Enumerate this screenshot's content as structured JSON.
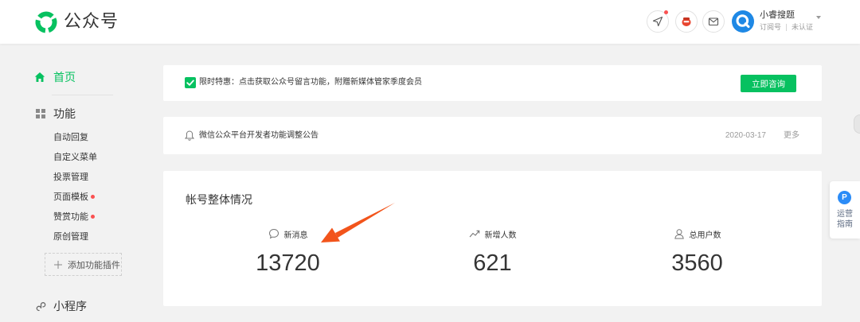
{
  "colors": {
    "accent": "#07c160",
    "badge_red": "#fa5151",
    "avatar_blue": "#1e88e5",
    "guide_blue": "#2b8cf7",
    "annotation_arrow": "#f2541b",
    "page_background": "#f2f2f2"
  },
  "header": {
    "logo_icon": "wechat-mp-logo-icon",
    "logo_text": "公众号",
    "toolbar_icons": [
      "send-icon",
      "wallet-icon",
      "mail-icon"
    ],
    "notification_dot": true,
    "account": {
      "avatar_icon": "avatar",
      "name": "小睿搜题",
      "type": "订阅号",
      "status": "未认证"
    }
  },
  "sidebar": {
    "home": {
      "icon": "home-icon",
      "label": "首页",
      "active": true
    },
    "functions": {
      "icon": "grid-icon",
      "label": "功能",
      "items": [
        {
          "label": "自动回复",
          "new": false
        },
        {
          "label": "自定义菜单",
          "new": false
        },
        {
          "label": "投票管理",
          "new": false
        },
        {
          "label": "页面模板",
          "new": true
        },
        {
          "label": "赞赏功能",
          "new": true
        },
        {
          "label": "原创管理",
          "new": false
        }
      ],
      "add_plugin": {
        "icon": "plus-icon",
        "label": "添加功能插件"
      }
    },
    "miniprogram": {
      "icon": "miniprogram-icon",
      "label": "小程序"
    }
  },
  "promo": {
    "icon": "check-icon",
    "text": "限时特惠：点击获取公众号留言功能，附赠新媒体管家季度会员",
    "button_label": "立即咨询"
  },
  "notice": {
    "icon": "bell-icon",
    "text": "微信公众平台开发者功能调整公告",
    "date": "2020-03-17",
    "more_label": "更多"
  },
  "overview": {
    "title": "帐号整体情况",
    "stats": [
      {
        "icon": "chat-bubble-icon",
        "label": "新消息",
        "value": "13720"
      },
      {
        "icon": "trend-up-icon",
        "label": "新增人数",
        "value": "621"
      },
      {
        "icon": "user-icon",
        "label": "总用户数",
        "value": "3560"
      }
    ]
  },
  "guide": {
    "icon_letter": "P",
    "label": "运营指南"
  }
}
